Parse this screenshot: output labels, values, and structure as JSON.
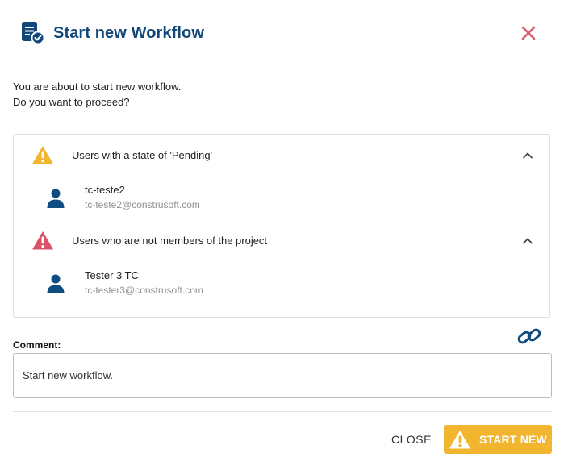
{
  "dialog": {
    "title": "Start new Workflow",
    "intro_line1": "You are about to start new workflow.",
    "intro_line2": "Do you want to proceed?"
  },
  "groups": [
    {
      "label": "Users with a state of 'Pending'",
      "icon": "warning-triangle-amber-icon",
      "users": [
        {
          "name": "tc-teste2",
          "email": "tc-teste2@construsoft.com"
        }
      ]
    },
    {
      "label": "Users who are not members of the project",
      "icon": "warning-triangle-red-icon",
      "users": [
        {
          "name": "Tester 3 TC",
          "email": "tc-tester3@construsoft.com"
        }
      ]
    }
  ],
  "comment": {
    "label": "Comment:",
    "value": "Start new workflow."
  },
  "footer": {
    "close_label": "CLOSE",
    "start_label": "START NEW"
  },
  "colors": {
    "title": "#12477a",
    "accent_blue": "#0f4c81",
    "warning_amber": "#f2b530",
    "warning_red": "#d9546a",
    "close_x": "#d45c6e"
  }
}
